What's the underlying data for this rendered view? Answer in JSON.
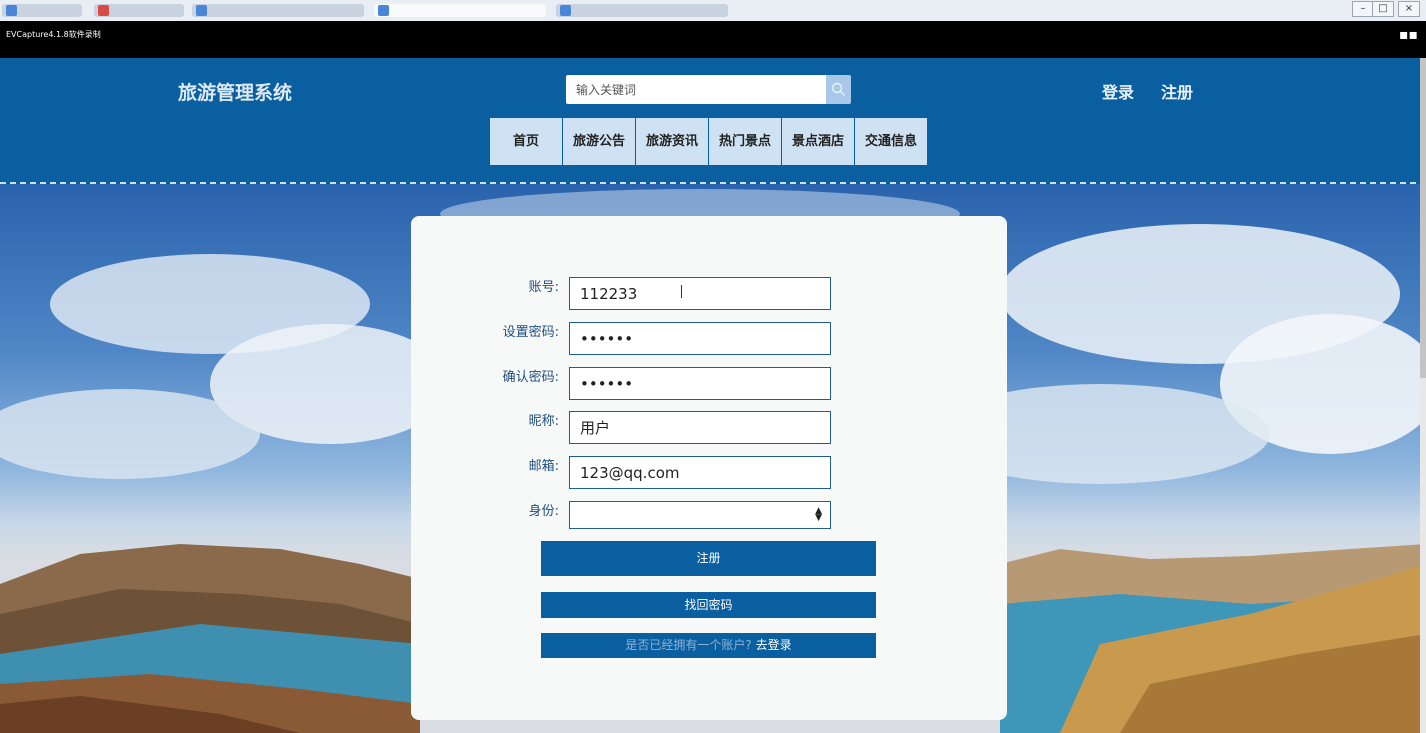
{
  "recorder": {
    "title": "EVCapture4.1.8软件录制"
  },
  "header": {
    "site_title": "旅游管理系统",
    "search_placeholder": "输入关键词",
    "login_label": "登录",
    "register_label": "注册"
  },
  "nav": {
    "items": [
      {
        "label": "首页"
      },
      {
        "label": "旅游公告"
      },
      {
        "label": "旅游资讯"
      },
      {
        "label": "热门景点"
      },
      {
        "label": "景点酒店"
      },
      {
        "label": "交通信息"
      }
    ]
  },
  "form": {
    "account": {
      "label": "账号:",
      "value": "112233"
    },
    "password": {
      "label": "设置密码:",
      "value": "••••••"
    },
    "confirm": {
      "label": "确认密码:",
      "value": "••••••"
    },
    "nickname": {
      "label": "昵称:",
      "value": "用户"
    },
    "email": {
      "label": "邮箱:",
      "value": "123@qq.com"
    },
    "identity": {
      "label": "身份:",
      "value": ""
    },
    "register_button": "注册",
    "forgot_button": "找回密码",
    "have_account_text": "是否已经拥有一个账户?",
    "go_login_link": "去登录"
  },
  "colors": {
    "brand": "#0a5fa0",
    "nav_bg": "#cfe2f3",
    "card_bg": "#f7f8f8"
  }
}
